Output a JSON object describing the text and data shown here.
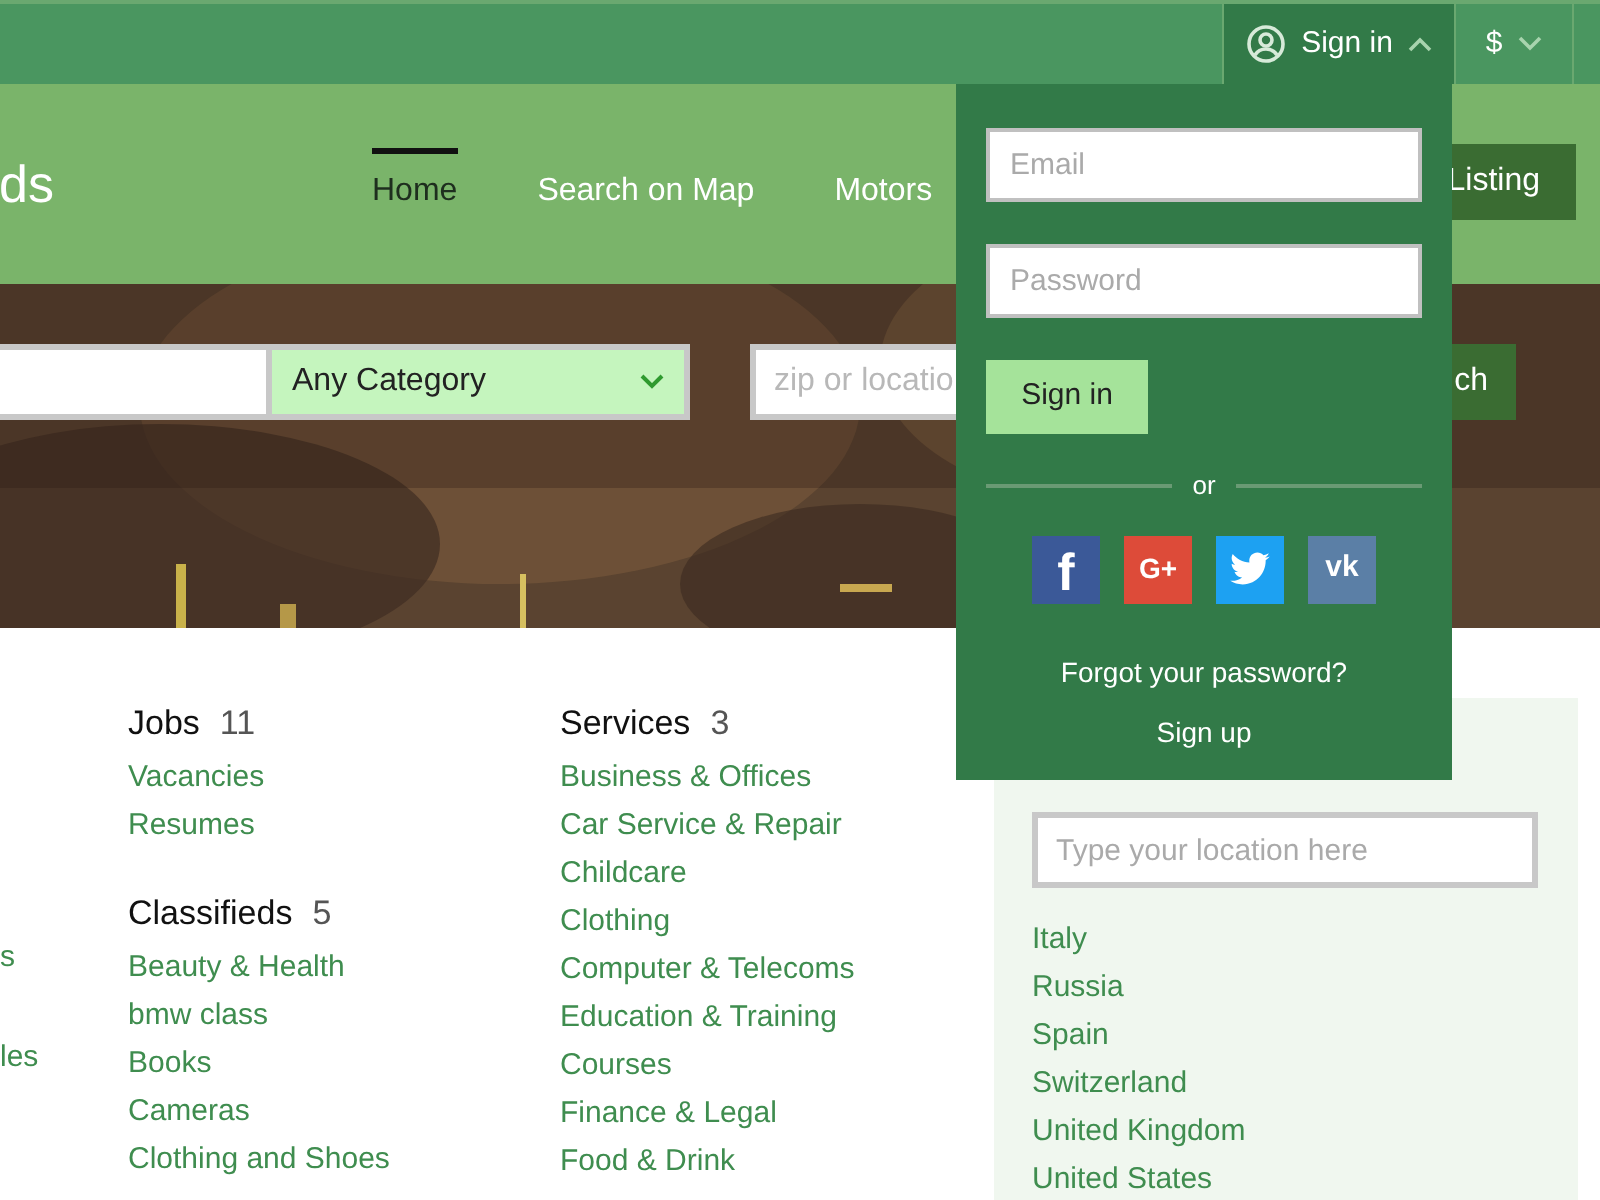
{
  "top_bar": {
    "sign_in": {
      "label": "Sign in",
      "expanded": true
    },
    "currency": {
      "label": "$",
      "expanded": false
    }
  },
  "header": {
    "logo_text": "ds",
    "nav": [
      {
        "label": "Home",
        "selected": true
      },
      {
        "label": "Search on Map",
        "selected": false
      },
      {
        "label": "Motors",
        "selected": false
      }
    ],
    "add_listing": "Listing"
  },
  "search": {
    "category": "Any Category",
    "location_placeholder": "zip or locatio",
    "button": "ch"
  },
  "login_dropdown": {
    "email_placeholder": "Email",
    "password_placeholder": "Password",
    "submit": "Sign in",
    "divider": "or",
    "social": [
      {
        "kind": "facebook",
        "label": "f"
      },
      {
        "kind": "google",
        "label": "G+"
      },
      {
        "kind": "twitter"
      },
      {
        "kind": "vk",
        "label": "vk"
      }
    ],
    "forgot": "Forgot your password?",
    "sign_up": "Sign up"
  },
  "categories": {
    "column_1": [
      "s",
      "les"
    ],
    "columns": [
      {
        "groups": [
          {
            "title": "Jobs",
            "count": "11",
            "items": [
              "Vacancies",
              "Resumes"
            ]
          },
          {
            "title": "Classifieds",
            "count": "5",
            "items": [
              "Beauty & Health",
              "bmw class",
              "Books",
              "Cameras",
              "Clothing and Shoes"
            ]
          }
        ]
      },
      {
        "groups": [
          {
            "title": "Services",
            "count": "3",
            "items": [
              "Business & Offices",
              "Car Service & Repair",
              "Childcare",
              "Clothing",
              "Computer & Telecoms",
              "Education & Training Courses",
              "Finance & Legal",
              "Food & Drink"
            ]
          }
        ]
      }
    ]
  },
  "locations": {
    "placeholder": "Type your location here",
    "countries": [
      "Italy",
      "Russia",
      "Spain",
      "Switzerland",
      "United Kingdom",
      "United States"
    ]
  }
}
